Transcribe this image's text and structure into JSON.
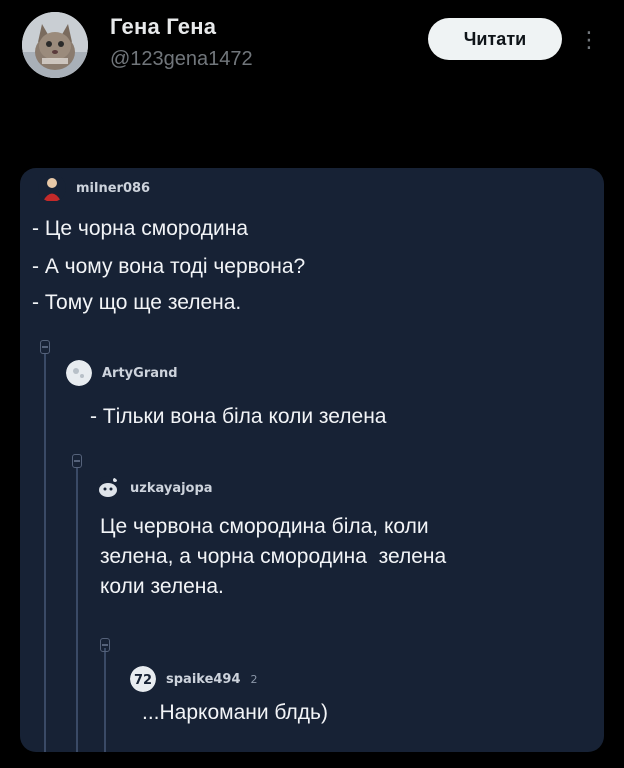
{
  "post": {
    "author": {
      "display_name": "Гена Гена",
      "handle": "@123gena1472"
    },
    "follow_label": "Читати",
    "more_icon": "⋮"
  },
  "screenshot": {
    "comments": [
      {
        "username": "milner086",
        "lines": [
          "- Це чорна смородина",
          "- А чому вона тоді червона?",
          "- Тому що ще зелена."
        ]
      },
      {
        "username": "ArtyGrand",
        "lines": [
          "- Тільки вона біла коли зелена"
        ]
      },
      {
        "username": "uzkayajopa",
        "lines": [
          "Це червона смородина біла, коли",
          "зелена, а чорна смородина  зелена",
          "коли зелена."
        ]
      },
      {
        "username": "spaike494",
        "badge": "2",
        "lines": [
          "...Наркомани блдь)"
        ]
      }
    ]
  }
}
